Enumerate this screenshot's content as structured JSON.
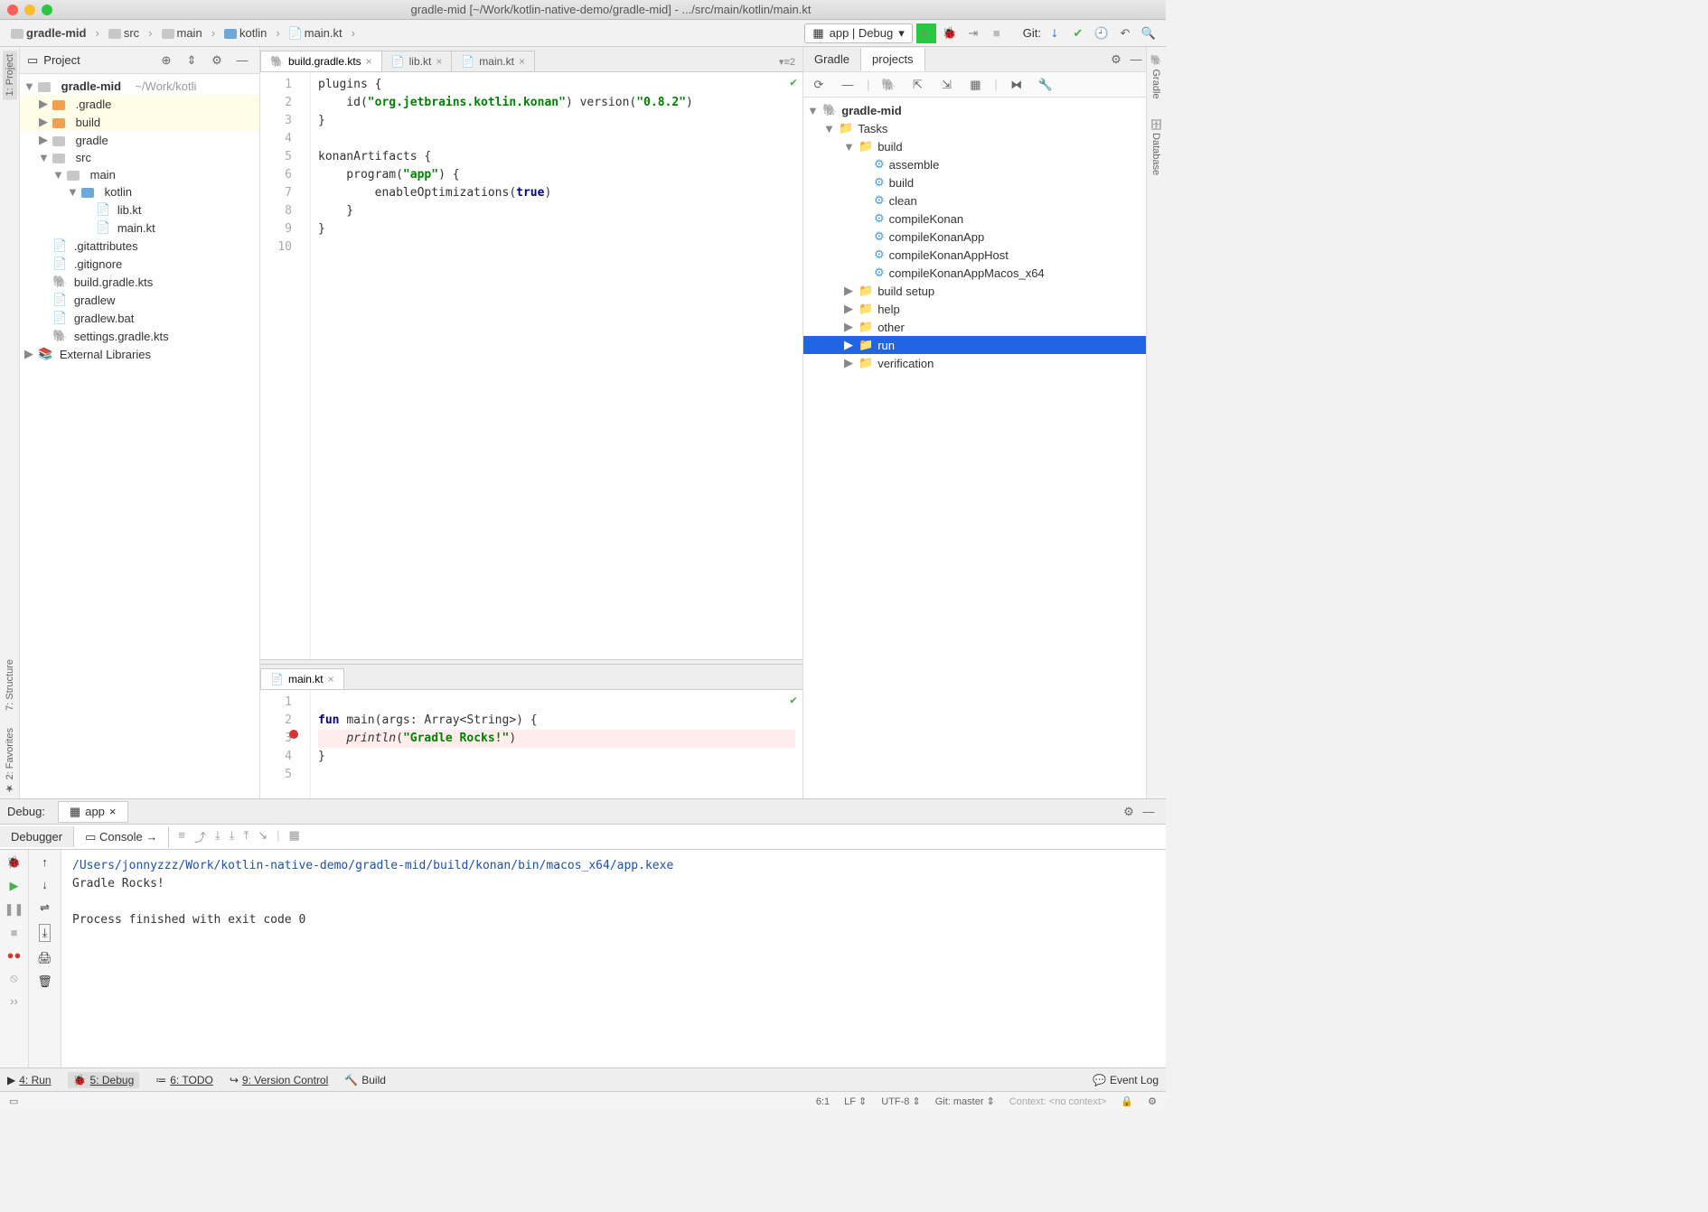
{
  "titlebar": "gradle-mid [~/Work/kotlin-native-demo/gradle-mid] - .../src/main/kotlin/main.kt",
  "breadcrumbs": [
    "gradle-mid",
    "src",
    "main",
    "kotlin",
    "main.kt"
  ],
  "runconfig": "app | Debug",
  "git_label": "Git:",
  "project_panel_title": "Project",
  "project_tree": {
    "root": "gradle-mid",
    "root_path": "~/Work/kotli",
    "dgradled": ".gradle",
    "build": "build",
    "gradle": "gradle",
    "src": "src",
    "main": "main",
    "kotlin": "kotlin",
    "lib": "lib.kt",
    "mainkt": "main.kt",
    "gitattributes": ".gitattributes",
    "gitignore": ".gitignore",
    "buildgradle": "build.gradle.kts",
    "gradlew": "gradlew",
    "gradlewbat": "gradlew.bat",
    "settings": "settings.gradle.kts",
    "extlib": "External Libraries"
  },
  "editor_tabs": {
    "t1": "build.gradle.kts",
    "t2": "lib.kt",
    "t3": "main.kt",
    "split_indicator": "2"
  },
  "editor1": {
    "line_numbers": "1\n2\n3\n4\n5\n6\n7\n8\n9\n10",
    "l1a": "plugins {",
    "l2a": "    id(",
    "l2b": "\"org.jetbrains.kotlin.konan\"",
    "l2c": ") version(",
    "l2d": "\"0.8.2\"",
    "l2e": ")",
    "l3": "}",
    "l4": "",
    "l5": "konanArtifacts {",
    "l6a": "    program(",
    "l6b": "\"app\"",
    "l6c": ") {",
    "l7a": "        enableOptimizations(",
    "l7b": "true",
    "l7c": ")",
    "l8": "    }",
    "l9": "}"
  },
  "editor2_tab": "main.kt",
  "editor2": {
    "line_numbers": "1\n2\n3\n4\n5",
    "l2a": "fun ",
    "l2b": "main(args: Array<String>) {",
    "l3a": "    ",
    "l3b": "println",
    "l3c": "(",
    "l3d": "\"Gradle Rocks!\"",
    "l3e": ")",
    "l4": "}"
  },
  "gradle_tabs": {
    "t1": "Gradle",
    "t2": "projects"
  },
  "gradle_tree": {
    "root": "gradle-mid",
    "tasks": "Tasks",
    "build": "build",
    "task_assemble": "assemble",
    "task_build": "build",
    "task_clean": "clean",
    "task_compileKonan": "compileKonan",
    "task_compileKonanApp": "compileKonanApp",
    "task_compileKonanAppHost": "compileKonanAppHost",
    "task_compileKonanAppMacos": "compileKonanAppMacos_x64",
    "buildsetup": "build setup",
    "help": "help",
    "other": "other",
    "run": "run",
    "verification": "verification"
  },
  "debug": {
    "title": "Debug:",
    "tab": "app",
    "debugger": "Debugger",
    "console": "Console",
    "path": "/Users/jonnyzzz/Work/kotlin-native-demo/gradle-mid/build/konan/bin/macos_x64/app.kexe",
    "out1": "Gradle Rocks!",
    "out2": "Process finished with exit code 0"
  },
  "leftstrip": {
    "structure": "7: Structure",
    "favorites": "2: Favorites",
    "project": "1: Project"
  },
  "rightstrip": {
    "gradle": "Gradle",
    "database": "Database"
  },
  "bottombar": {
    "run": "4: Run",
    "debug": "5: Debug",
    "todo": "6: TODO",
    "vcs": "9: Version Control",
    "build": "Build",
    "eventlog": "Event Log"
  },
  "statusbar": {
    "pos": "6:1",
    "le": "LF",
    "enc": "UTF-8",
    "git": "Git: master",
    "ctx": "Context: <no context>"
  }
}
